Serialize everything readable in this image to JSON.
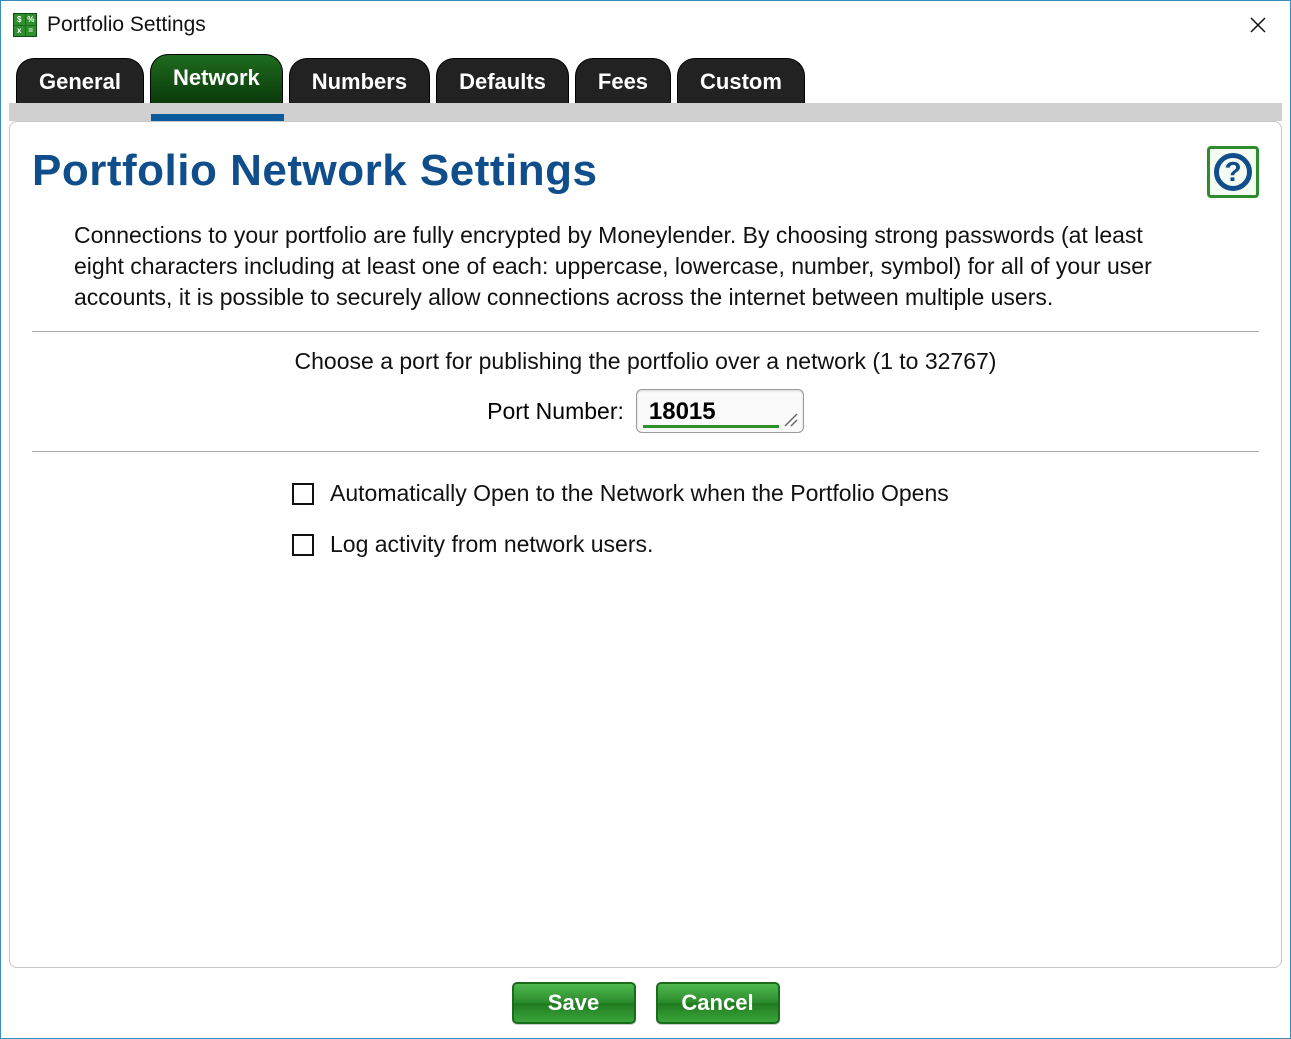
{
  "window": {
    "title": "Portfolio Settings"
  },
  "tabs": [
    {
      "label": "General"
    },
    {
      "label": "Network"
    },
    {
      "label": "Numbers"
    },
    {
      "label": "Defaults"
    },
    {
      "label": "Fees"
    },
    {
      "label": "Custom"
    }
  ],
  "active_tab_index": 1,
  "page": {
    "title": "Portfolio Network Settings",
    "description": "Connections to your portfolio are fully encrypted by Moneylender. By choosing strong passwords (at least eight characters including at least one of each: uppercase, lowercase, number, symbol) for all of your user accounts, it is possible to securely allow connections across the internet between multiple users.",
    "port_instruction": "Choose a port for publishing the portfolio over a network (1 to 32767)",
    "port_label": "Port Number:",
    "port_value": "18015",
    "checkboxes": [
      {
        "label": "Automatically Open to the Network when the Portfolio Opens",
        "checked": false
      },
      {
        "label": "Log activity from network users.",
        "checked": false
      }
    ]
  },
  "footer": {
    "save_label": "Save",
    "cancel_label": "Cancel"
  }
}
